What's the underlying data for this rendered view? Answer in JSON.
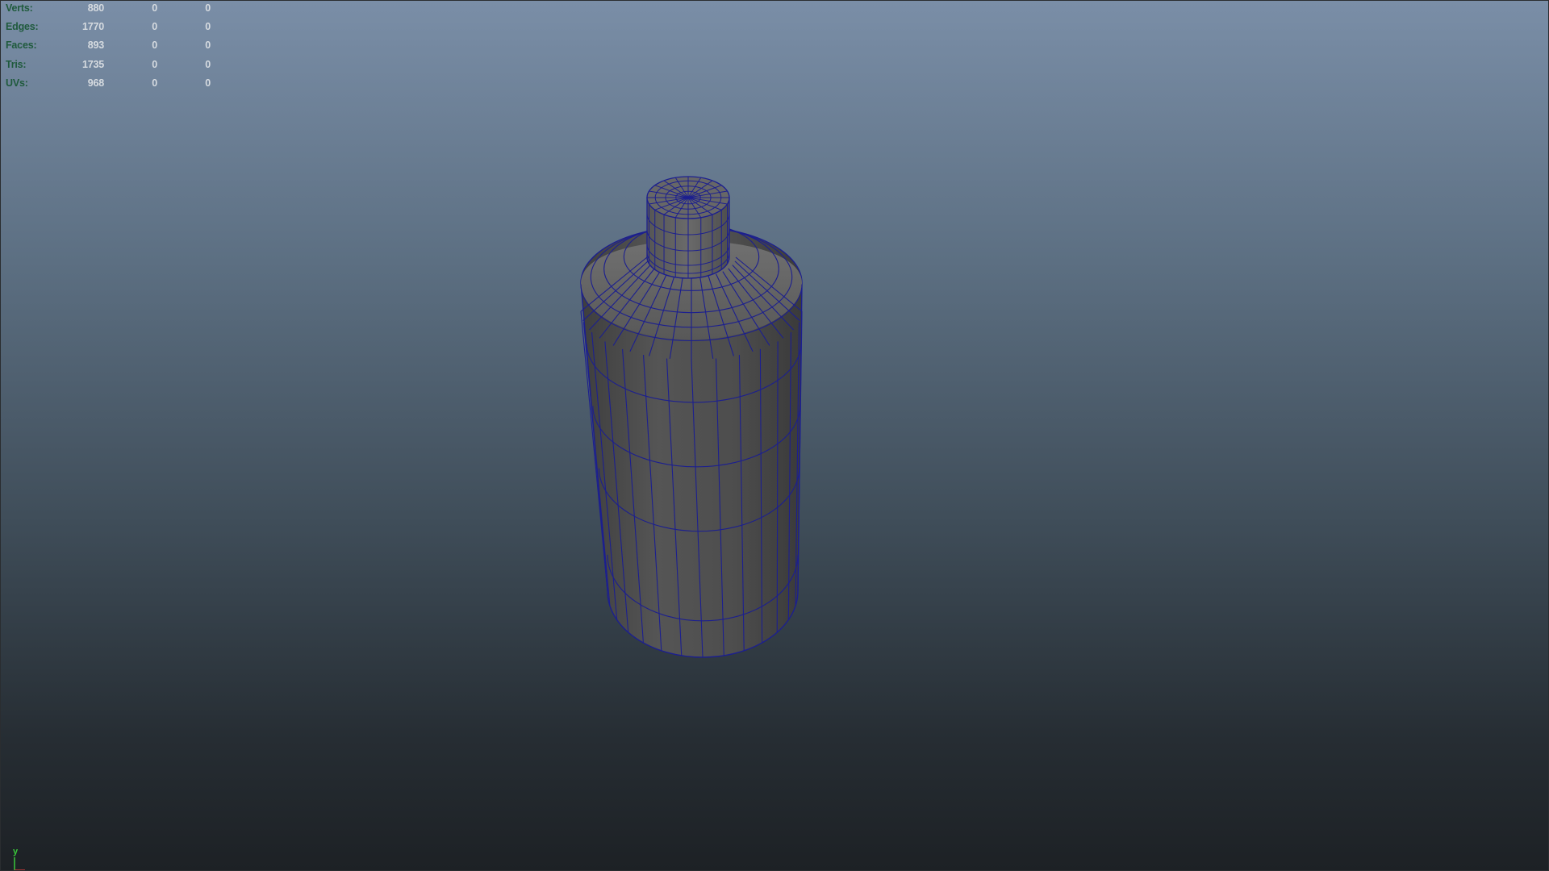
{
  "viewport": {
    "background_top": "#7a8ea7",
    "background_bottom": "#1d2125",
    "wireframe_color": "#1c1f8f",
    "shaded_color": "#4a4a4a"
  },
  "stats": [
    {
      "label": "Verts:",
      "v1": "880",
      "v2": "0",
      "v3": "0"
    },
    {
      "label": "Edges:",
      "v1": "1770",
      "v2": "0",
      "v3": "0"
    },
    {
      "label": "Faces:",
      "v1": "893",
      "v2": "0",
      "v3": "0"
    },
    {
      "label": "Tris:",
      "v1": "1735",
      "v2": "0",
      "v3": "0"
    },
    {
      "label": "UVs:",
      "v1": "968",
      "v2": "0",
      "v3": "0"
    }
  ],
  "axis_gizmo": {
    "y_label": "y"
  },
  "mesh": {
    "object": "bottle-mesh-icon"
  }
}
